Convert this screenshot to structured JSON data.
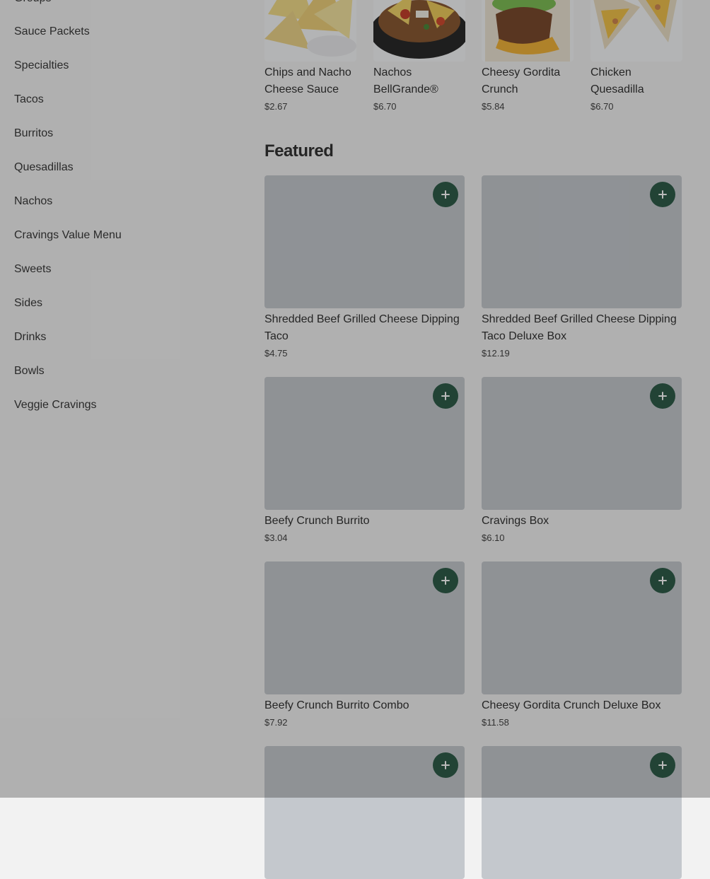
{
  "sidebar": {
    "items": [
      {
        "label": "Groups"
      },
      {
        "label": "Sauce Packets"
      },
      {
        "label": "Specialties"
      },
      {
        "label": "Tacos"
      },
      {
        "label": "Burritos"
      },
      {
        "label": "Quesadillas"
      },
      {
        "label": "Nachos"
      },
      {
        "label": "Cravings Value Menu"
      },
      {
        "label": "Sweets"
      },
      {
        "label": "Sides"
      },
      {
        "label": "Drinks"
      },
      {
        "label": "Bowls"
      },
      {
        "label": "Veggie Cravings"
      }
    ]
  },
  "top_row": [
    {
      "name": "Chips and Nacho Cheese Sauce",
      "price": "$2.67"
    },
    {
      "name": "Nachos BellGrande®",
      "price": "$6.70"
    },
    {
      "name": "Cheesy Gordita Crunch",
      "price": "$5.84"
    },
    {
      "name": "Chicken Quesadilla",
      "price": "$6.70"
    }
  ],
  "featured": {
    "title": "Featured",
    "items": [
      {
        "name": "Shredded Beef Grilled Cheese Dipping Taco",
        "price": "$4.75"
      },
      {
        "name": "Shredded Beef Grilled Cheese Dipping Taco Deluxe Box",
        "price": "$12.19"
      },
      {
        "name": "Beefy Crunch Burrito",
        "price": "$3.04"
      },
      {
        "name": "Cravings Box",
        "price": "$6.10"
      },
      {
        "name": "Beefy Crunch Burrito Combo",
        "price": "$7.92"
      },
      {
        "name": "Cheesy Gordita Crunch Deluxe Box",
        "price": "$11.58"
      },
      {
        "name": "",
        "price": ""
      },
      {
        "name": "",
        "price": ""
      }
    ]
  },
  "colors": {
    "accent": "#2f5d49",
    "placeholder": "#c4c8cd",
    "overlay": "rgba(0,0,0,0.27)"
  },
  "icons": {
    "add": "plus-icon"
  }
}
